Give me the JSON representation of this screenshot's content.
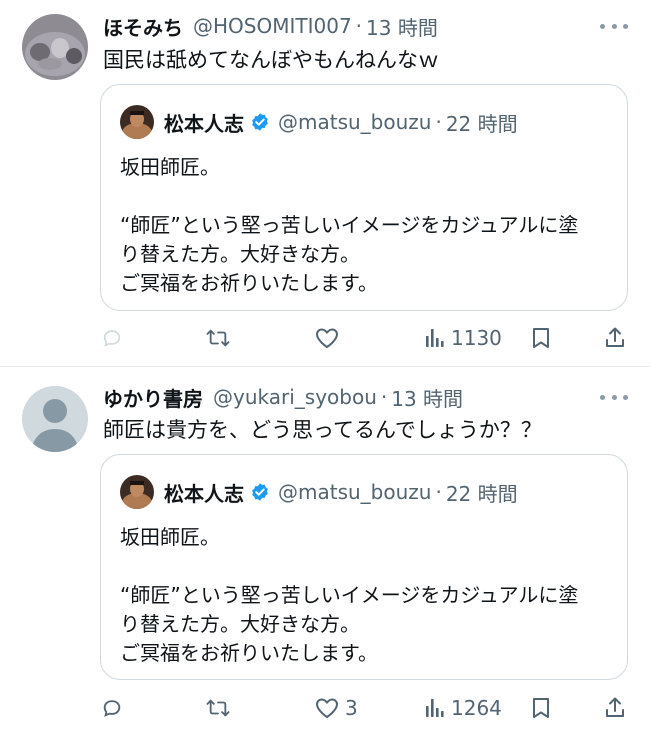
{
  "tweets": [
    {
      "name": "ほそみち",
      "handle": "@HOSOMITI007",
      "dot": "·",
      "time": "13 時間",
      "text": "国民は舐めてなんぼやもんねんなｗ",
      "quote": {
        "name": "松本人志",
        "handle": "@matsu_bouzu",
        "dot": "·",
        "time": "22 時間",
        "text": "坂田師匠。\n\n“師匠”という堅っ苦しいイメージをカジュアルに塗\nり替えた方。大好きな方。\nご冥福をお祈りいたします。"
      },
      "actions": {
        "reply": "",
        "retweet": "",
        "like": "",
        "views": "1130"
      }
    },
    {
      "name": "ゆかり書房",
      "handle": "@yukari_syobou",
      "dot": "·",
      "time": "13 時間",
      "text": "師匠は貴方を、どう思ってるんでしょうか？？",
      "quote": {
        "name": "松本人志",
        "handle": "@matsu_bouzu",
        "dot": "·",
        "time": "22 時間",
        "text": "坂田師匠。\n\n“師匠”という堅っ苦しいイメージをカジュアルに塗\nり替えた方。大好きな方。\nご冥福をお祈りいたします。"
      },
      "actions": {
        "reply": "",
        "retweet": "",
        "like": "3",
        "views": "1264"
      }
    }
  ],
  "icons": [
    "more-icon",
    "verified-badge-icon",
    "reply-icon",
    "retweet-icon",
    "like-icon",
    "views-icon",
    "bookmark-icon",
    "share-icon"
  ],
  "colors": {
    "text": "#0f1419",
    "secondary": "#536471",
    "border": "#cfd9de",
    "verified": "#1d9bf0"
  }
}
